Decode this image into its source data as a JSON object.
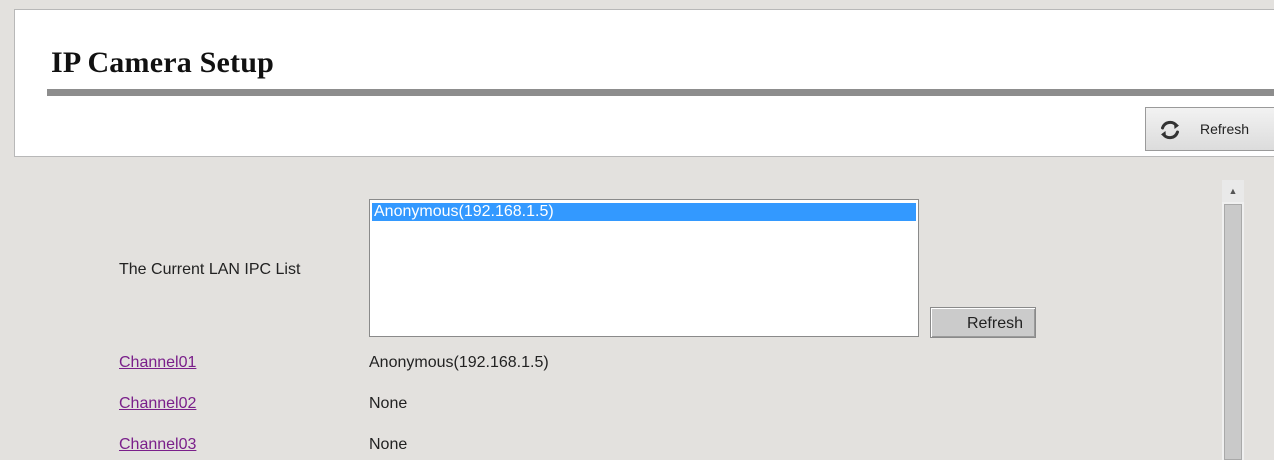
{
  "header": {
    "title": "IP Camera Setup",
    "toolbar_refresh_label": "Refresh",
    "toolbar_refresh_icon": "refresh-icon"
  },
  "lan": {
    "label": "The Current LAN IPC List",
    "items": [
      "Anonymous(192.168.1.5)"
    ],
    "selected_index": 0,
    "refresh_label": "Refresh"
  },
  "channels": [
    {
      "name": "Channel01",
      "value": "Anonymous(192.168.1.5)"
    },
    {
      "name": "Channel02",
      "value": "None"
    },
    {
      "name": "Channel03",
      "value": "None"
    }
  ],
  "colors": {
    "selection": "#3399ff",
    "link": "#7a1f8a",
    "rule": "#8d8d8d",
    "background": "#e3e1de"
  },
  "scrollbar": {
    "up_arrow_icon": "scroll-up-arrow-icon"
  }
}
